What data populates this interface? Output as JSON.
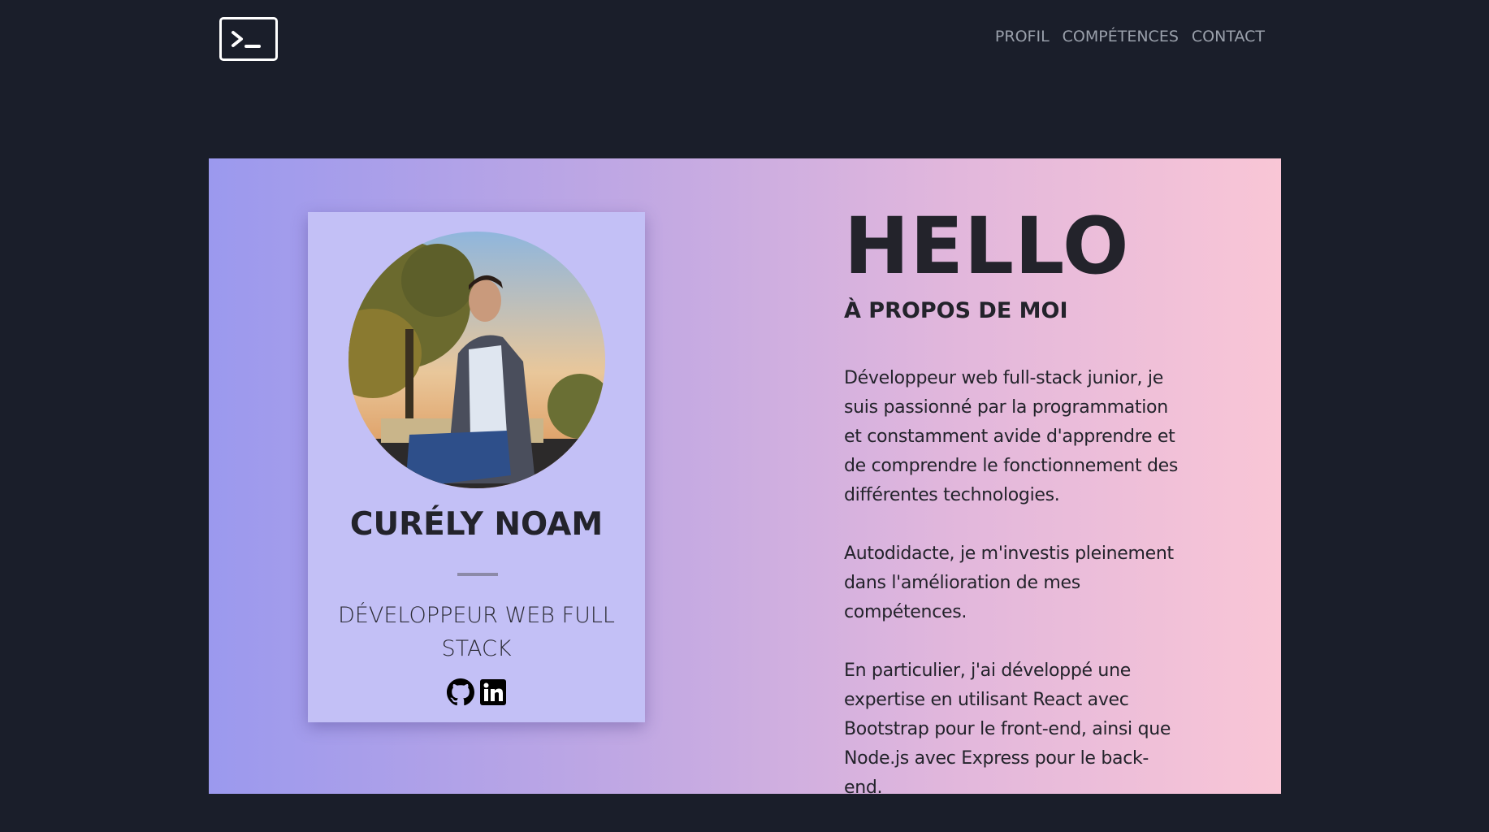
{
  "navbar": {
    "logo_icon": "terminal-icon",
    "links": [
      "PROFIL",
      "COMPÉTENCES",
      "CONTACT"
    ]
  },
  "profile_card": {
    "name": "CURÉLY NOAM",
    "role": "DÉVELOPPEUR WEB FULL STACK",
    "socials": [
      "github-icon",
      "linkedin-icon"
    ]
  },
  "about": {
    "greeting": "HELLO",
    "title": "À PROPOS DE MOI",
    "paragraph_1": "Développeur web full-stack junior, je suis passionné par la programmation et constamment avide d'apprendre et de comprendre le fonctionnement des différentes technologies.",
    "paragraph_2": "Autodidacte, je m'investis pleinement dans l'amélioration de mes compétences.",
    "paragraph_3": "En particulier, j'ai développé une expertise en utilisant React avec Bootstrap pour le front-end, ainsi que Node.js avec Express pour le back-end."
  },
  "colors": {
    "page_bg": "#1a1e2a",
    "gradient_start": "#9b99ee",
    "gradient_end": "#f9c6d6",
    "card_bg": "#c3c0f6",
    "nav_link": "#9aa0ab"
  }
}
